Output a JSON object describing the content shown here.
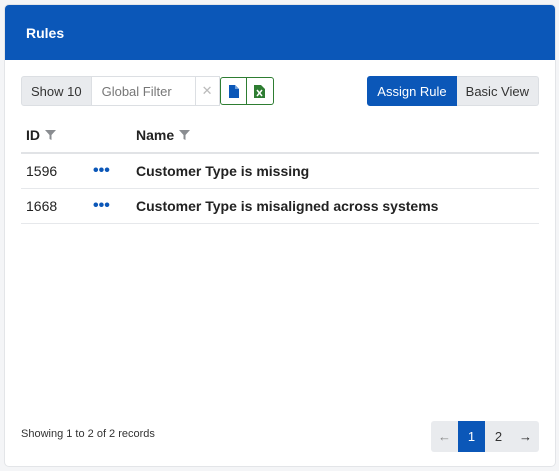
{
  "panel": {
    "title": "Rules"
  },
  "toolbar": {
    "show_label": "Show 10",
    "filter_placeholder": "Global Filter",
    "clear_glyph": "✕",
    "export_buttons": [
      {
        "icon": "file-icon",
        "color": "#0b57b8"
      },
      {
        "icon": "excel-icon",
        "color": "#2e7d32"
      }
    ],
    "view_buttons": [
      {
        "label": "Assign Rule",
        "active": true
      },
      {
        "label": "Basic View",
        "active": false
      }
    ]
  },
  "table": {
    "columns": [
      {
        "label": "ID",
        "filterable": true
      },
      {
        "label": "",
        "filterable": false
      },
      {
        "label": "Name",
        "filterable": true
      }
    ],
    "rows": [
      {
        "id": "1596",
        "actions": "•••",
        "name": "Customer Type is missing"
      },
      {
        "id": "1668",
        "actions": "•••",
        "name": "Customer Type is misaligned across systems"
      }
    ]
  },
  "footer": {
    "summary": "Showing 1 to 2 of 2 records",
    "pages": [
      "1",
      "2"
    ],
    "current_page": "1",
    "prev_glyph": "←",
    "next_glyph": "→"
  },
  "colors": {
    "accent": "#0b57b8",
    "excel": "#2e7d32"
  }
}
